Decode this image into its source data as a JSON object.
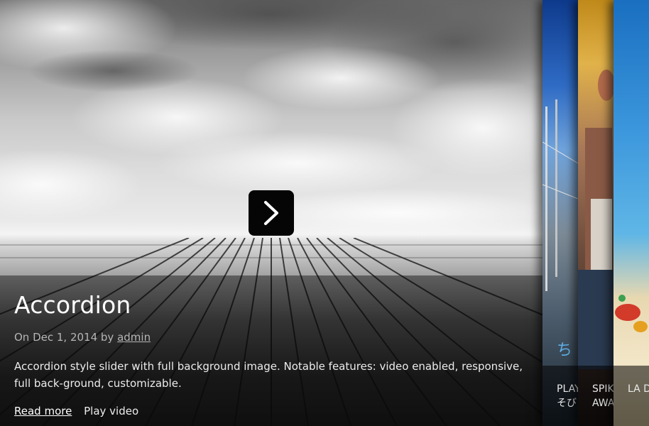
{
  "main_slide": {
    "title": "Accordion",
    "meta_prefix": "On Dec 1, 2014 by",
    "author": "admin",
    "excerpt": "Accordion style slider with full background image. Notable features: video enabled, responsive, full back-ground, customizable.",
    "read_more": "Read more",
    "play_video": "Play video"
  },
  "panels": [
    {
      "line1": "PLAY",
      "line2": "そび"
    },
    {
      "line1": "SPIK",
      "line2": "AWA"
    },
    {
      "line1": "LA D",
      "line2": ""
    }
  ],
  "colors": {
    "play_button_bg": "#050505",
    "caption_overlay": "rgba(0,0,0,0.42)"
  }
}
